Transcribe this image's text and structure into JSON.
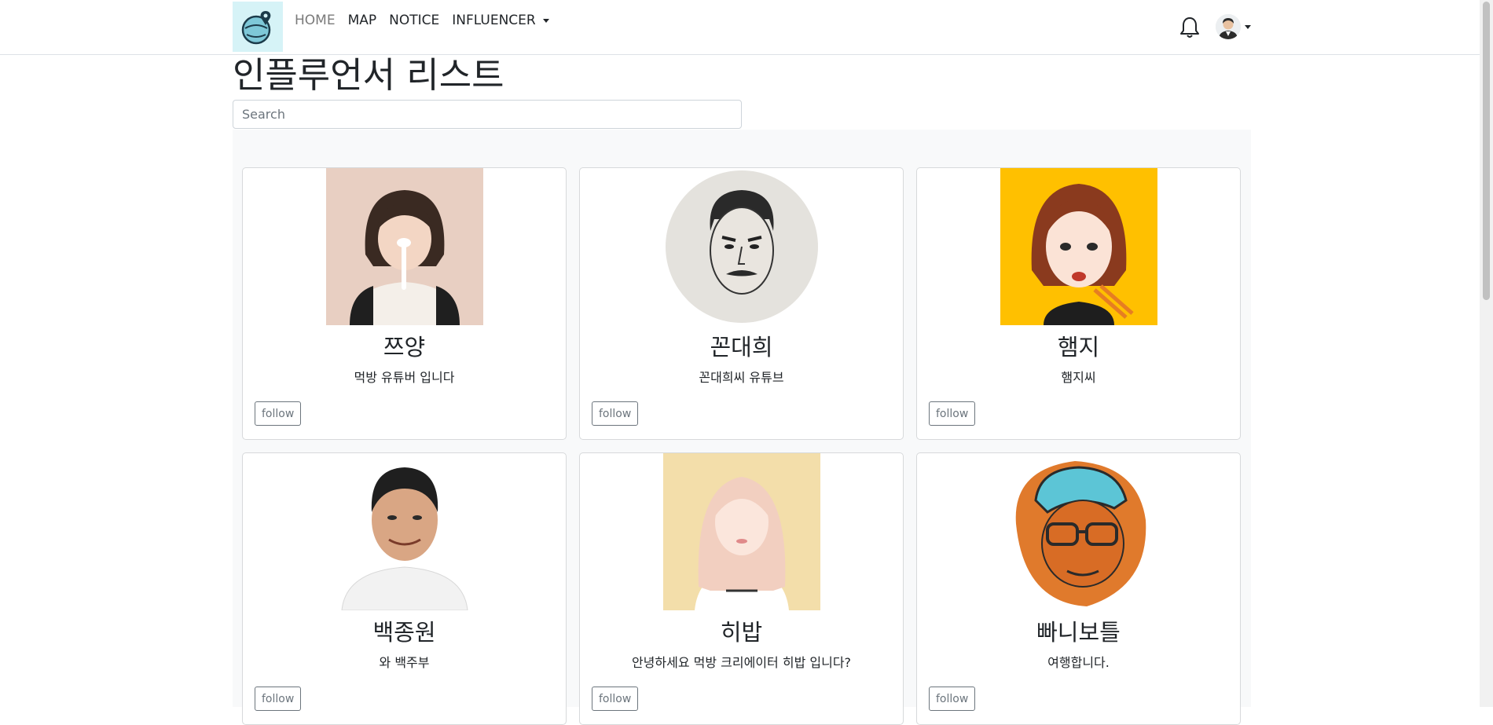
{
  "nav": {
    "links": [
      {
        "label": "HOME"
      },
      {
        "label": "MAP"
      },
      {
        "label": "NOTICE"
      },
      {
        "label": "INFLUENCER"
      }
    ]
  },
  "header": {
    "title": "인플루언서 리스트",
    "search_placeholder": "Search"
  },
  "cards": [
    {
      "name": "쯔양",
      "desc": "먹방 유튜버 입니다",
      "button": "follow"
    },
    {
      "name": "꼰대희",
      "desc": "꼰대희씨 유튜브",
      "button": "follow"
    },
    {
      "name": "햄지",
      "desc": "햄지씨",
      "button": "follow"
    },
    {
      "name": "백종원",
      "desc": "와 백주부",
      "button": "follow"
    },
    {
      "name": "히밥",
      "desc": "안녕하세요 먹방 크리에이터 히밥 입니다?",
      "button": "follow"
    },
    {
      "name": "빠니보틀",
      "desc": "여행합니다.",
      "button": "follow"
    }
  ],
  "colors": {
    "logo_bg": "#d6f3f7",
    "grid_bg": "#f8f9fa",
    "hamzy_bg": "#ffc000",
    "panibottle_bg": "#e07a2c"
  }
}
